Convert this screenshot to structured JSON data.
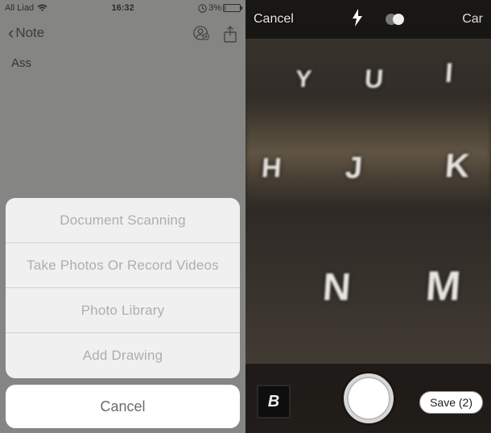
{
  "left": {
    "status": {
      "carrier": "All Liad",
      "time": "16:32",
      "battery_pct": "3%"
    },
    "nav": {
      "back_label": "Note"
    },
    "note": {
      "text": "Ass"
    },
    "sheet": {
      "scan": "Document Scanning",
      "camera": "Take Photos Or Record Videos",
      "library": "Photo Library",
      "drawing": "Add Drawing",
      "cancel": "Cancel"
    }
  },
  "right": {
    "top": {
      "cancel": "Cancel",
      "mode": "Car"
    },
    "bottom": {
      "thumb_letter": "B",
      "save_label": "Save (2)"
    },
    "keys": [
      "Y",
      "U",
      "I",
      "H",
      "J",
      "K",
      "N",
      "M"
    ]
  }
}
